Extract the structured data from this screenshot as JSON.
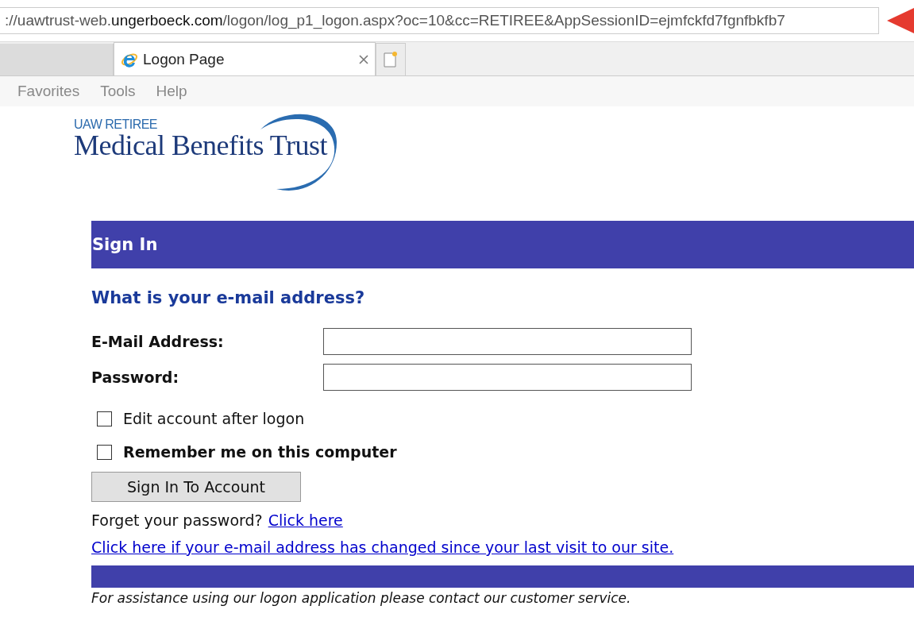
{
  "browser": {
    "address": "://uawtrust-web.**ungerboeck.com**/logon/log_p1_logon.aspx?oc=10&cc=RETIREE&AppSessionID=ejmfckfd7fgnfbkfb7",
    "tabs": [
      {
        "label": "Logon Page",
        "selected": true
      }
    ],
    "menu": [
      "Favorites",
      "Tools",
      "Help"
    ]
  },
  "logo": {
    "small": "UAW RETIREE",
    "large": "Medical Benefits Trust"
  },
  "sign_in": {
    "title": "Sign In",
    "question": "What is your e-mail address?",
    "fields": [
      {
        "label": "E-Mail Address:"
      },
      {
        "label": "Password:"
      }
    ],
    "options": [
      {
        "label": "Edit account after logon",
        "checked": false,
        "bold": false
      },
      {
        "label": "Remember me on this computer",
        "checked": false,
        "bold": true
      }
    ],
    "button": "Sign In To Account",
    "forgot_text": "Forget your password?",
    "forgot_link": "Click here",
    "changed_link": "Click here if your e-mail address has changed since your last visit to our site.",
    "footer": "For assistance using our logon application please contact our customer service."
  }
}
